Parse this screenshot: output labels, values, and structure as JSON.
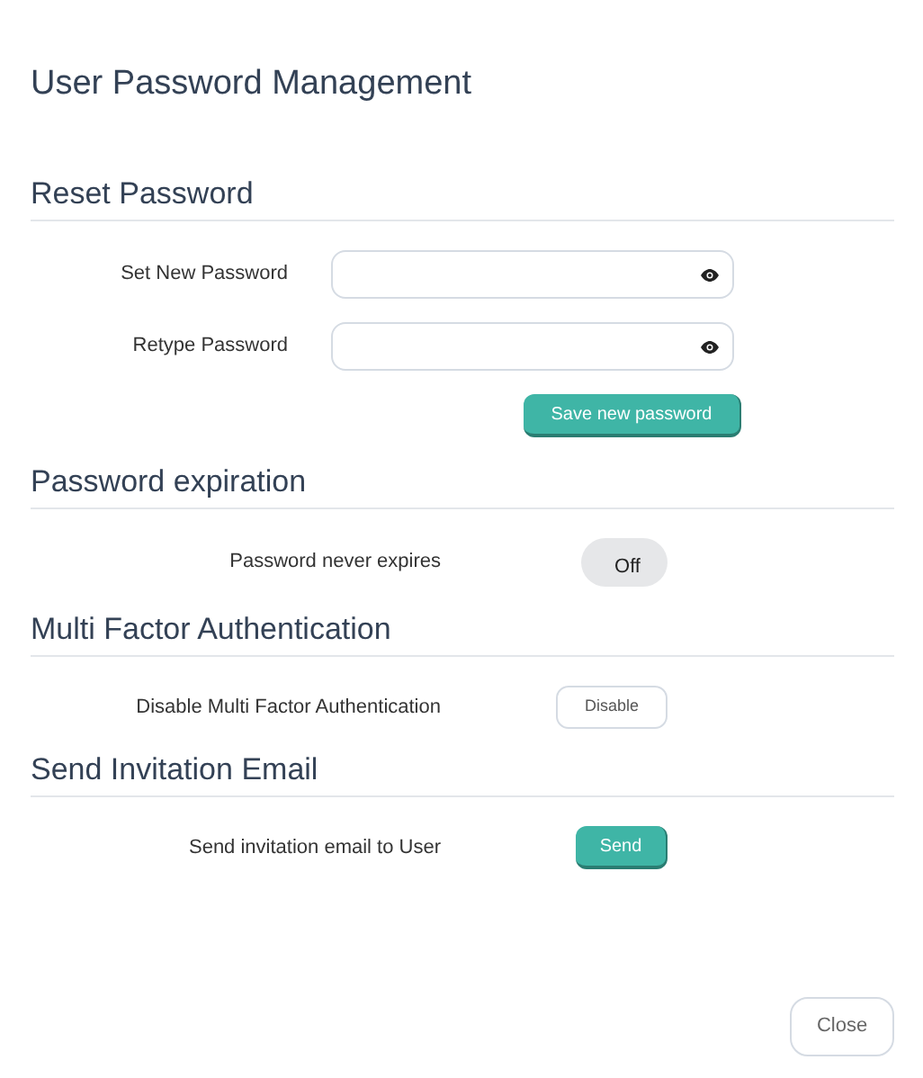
{
  "title": "User Password Management",
  "reset": {
    "heading": "Reset Password",
    "fields": [
      {
        "label": "Set New Password"
      },
      {
        "label": "Retype Password"
      }
    ],
    "save_button": "Save new password"
  },
  "expiration": {
    "heading": "Password expiration",
    "label": "Password never expires",
    "toggle": {
      "on": false,
      "text": "Off"
    }
  },
  "mfa": {
    "heading": "Multi Factor Authentication",
    "label": "Disable Multi Factor Authentication",
    "button": "Disable"
  },
  "invite": {
    "heading": "Send Invitation Email",
    "label": "Send invitation email to User",
    "button": "Send"
  },
  "close_button": "Close"
}
